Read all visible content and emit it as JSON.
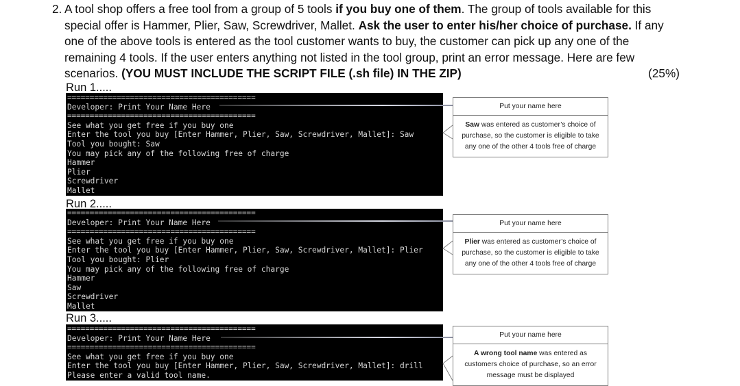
{
  "question": {
    "number": "2.",
    "segments": [
      {
        "text": "A tool shop offers a free tool from a group of 5 tools ",
        "bold": false
      },
      {
        "text": "if you buy one of them",
        "bold": true
      },
      {
        "text": ". The group of tools available for this special offer is Hammer, Plier, Saw, Screwdriver, Mallet. ",
        "bold": false
      },
      {
        "text": "Ask the user to enter his/her choice of purchase.",
        "bold": true
      },
      {
        "text": " If any one of the above tools is entered as the tool customer wants to buy, the customer can pick up any one of the remaining 4 tools. If the user enters anything not listed in the tool group, print an error message. Here are few scenarios.  ",
        "bold": false
      },
      {
        "text": "(YOU MUST INCLUDE THE SCRIPT FILE (.sh file) IN THE ZIP)",
        "bold": true
      }
    ],
    "weight": "(25%)"
  },
  "runs": [
    {
      "label": "Run 1.....",
      "separator": "==========================================",
      "developer_line": "Developer: Print Your Name Here",
      "lines": [
        "See what you get free if you buy one",
        "Enter the tool you buy [Enter Hammer, Plier, Saw, Screwdriver, Mallet]: Saw",
        "Tool you bought: Saw",
        "You may pick any of the following free of charge",
        "Hammer",
        "Plier",
        "Screwdriver",
        "Mallet"
      ],
      "callout": {
        "header": "Put your name here",
        "bold": "Saw",
        "text": " was entered as customer’s choice of purchase, so the customer is eligible to take any one of the other 4 tools free of charge"
      }
    },
    {
      "label": "Run 2.....",
      "separator": "==========================================",
      "developer_line": "Developer: Print Your Name Here",
      "lines": [
        "See what you get free if you buy one",
        "Enter the tool you buy [Enter Hammer, Plier, Saw, Screwdriver, Mallet]: Plier",
        "Tool you bought: Plier",
        "You may pick any of the following free of charge",
        "Hammer",
        "Saw",
        "Screwdriver",
        "Mallet"
      ],
      "callout": {
        "header": "Put your name here",
        "bold": "Plier",
        "text": " was entered as customer’s choice of purchase, so the customer is eligible to take any one of the other 4 tools free of charge"
      }
    },
    {
      "label": "Run 3.....",
      "separator": "==========================================",
      "developer_line": "Developer: Print Your Name Here",
      "lines": [
        "See what you get free if you buy one",
        "Enter the tool you buy [Enter Hammer, Plier, Saw, Screwdriver, Mallet]: drill",
        "Please enter a valid tool name."
      ],
      "callout": {
        "header": "Put your name here",
        "bold": "A wrong tool name",
        "text": " was entered as customers choice of purchase, so an error message must be displayed"
      }
    }
  ]
}
